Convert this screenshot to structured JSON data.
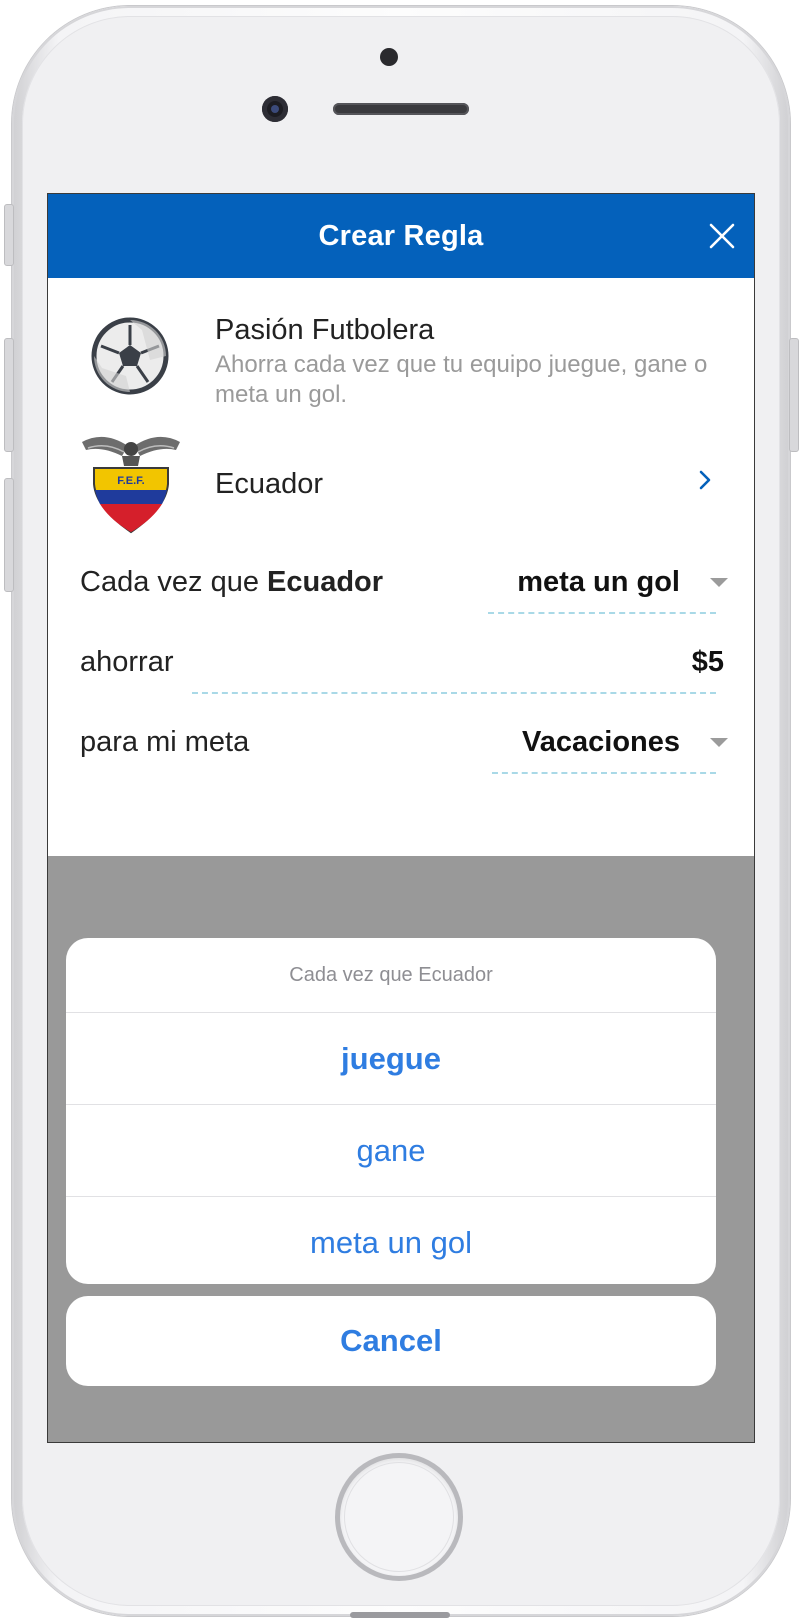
{
  "header": {
    "title": "Crear Regla"
  },
  "rule": {
    "title": "Pasión Futbolera",
    "description": "Ahorra cada vez que tu equipo juegue, gane o meta un gol."
  },
  "team": {
    "name": "Ecuador",
    "crest_text": "F.E.F."
  },
  "fields": {
    "trigger": {
      "label_prefix": "Cada vez que",
      "label_team": "Ecuador",
      "value": "meta un gol"
    },
    "amount": {
      "label": "ahorrar",
      "value": "$5"
    },
    "goal": {
      "label": "para mi meta",
      "value": "Vacaciones"
    }
  },
  "action_sheet": {
    "title": "Cada vez que Ecuador",
    "options": [
      "juegue",
      "gane",
      "meta un gol"
    ],
    "cancel_label": "Cancel"
  },
  "colors": {
    "header_bg": "#0461bb",
    "action_blue": "#2f7de1",
    "overlay": "#999999",
    "dashed_underline": "#a9d9e7"
  }
}
